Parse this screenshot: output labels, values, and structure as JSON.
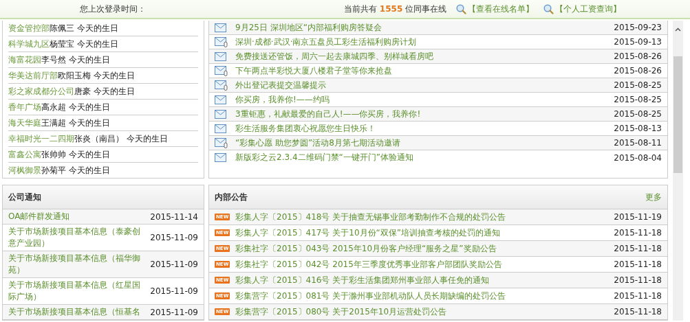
{
  "header": {
    "last_login_label": "您上次登录时间：",
    "online_prefix": "当前共有",
    "online_count": "1555",
    "online_suffix": "位同事在线",
    "links": [
      {
        "label": "【查看在线名单】"
      },
      {
        "label": "【个人工资查询】"
      }
    ]
  },
  "birthdays": [
    {
      "dept": "资金管控部",
      "name": "陈佩三 今天的生日"
    },
    {
      "dept": "科学城九区",
      "name": "杨莹宝 今天的生日"
    },
    {
      "dept": "海富花园",
      "name": "李号然 今天的生日"
    },
    {
      "dept": "华美达前厅部",
      "name": "欧阳玉梅 今天的生日"
    },
    {
      "dept": "彩之家成都分公司",
      "name": "唐豪 今天的生日"
    },
    {
      "dept": "香年广场",
      "name": "高永超 今天的生日"
    },
    {
      "dept": "海天华庭",
      "name": "王满超 今天的生日"
    },
    {
      "dept": "幸福时光一二四期",
      "name": "张炎（南昌） 今天的生日"
    },
    {
      "dept": "富鑫公寓",
      "name": "张帅帅 今天的生日"
    },
    {
      "dept": "河枫御景",
      "name": "孙菊平 今天的生日"
    }
  ],
  "messages": [
    {
      "kind": "mail",
      "title": "9月25日 深圳地区“内部福利购房答疑会",
      "date": "2015-09-23"
    },
    {
      "kind": "mail-attachment",
      "title": "深圳·成都·武汉·南京五盘员工彩生活福利购房计划",
      "date": "2015-09-13"
    },
    {
      "kind": "mail",
      "title": "免费接送还管饭，周六一起去康城四季、别样城看房吧",
      "date": "2015-08-26"
    },
    {
      "kind": "mail-attachment",
      "title": "下午两点半彩悦大厦八楼君子堂等你来抢盘",
      "date": "2015-08-26"
    },
    {
      "kind": "mail-attachment",
      "title": "外出登记表提交温馨提示",
      "date": "2015-08-25"
    },
    {
      "kind": "mail",
      "title": "你买房，我养你!——约吗",
      "date": "2015-08-25"
    },
    {
      "kind": "mail",
      "title": "3重钜惠，礼献最爱的自己人!——你买房，我养你!",
      "date": "2015-08-25"
    },
    {
      "kind": "mail",
      "title": "彩生活服务集团衷心祝愿您生日快乐！",
      "date": "2015-08-13"
    },
    {
      "kind": "mail-attachment",
      "title": "“彩集心愿 助您梦圆”活动8月第七期活动邀请",
      "date": "2015-08-11"
    },
    {
      "kind": "mail",
      "title": "新版彩之云2.3.4二维码门禁“一键开门”体验通知",
      "date": "2015-08-04"
    }
  ],
  "company_notices": {
    "title": "公司通知",
    "rows": [
      {
        "title": "OA邮件群发通知",
        "date": "2015-11-14"
      },
      {
        "title": "关于市场新接项目基本信息（泰豪创意产业园）",
        "date": "2015-11-09"
      },
      {
        "title": "关于市场新接项目基本信息（福华御苑）",
        "date": "2015-11-09"
      },
      {
        "title": "关于市场新接项目基本信息（红星国际广场）",
        "date": "2015-11-09"
      },
      {
        "title": "关于市场新接项目基本信息（恒基名",
        "date": "2015-11-09"
      }
    ]
  },
  "internal_notices": {
    "title": "内部公告",
    "more": "更多",
    "rows": [
      {
        "badge": "NEW",
        "title": "彩集人字〔2015〕418号 关于抽查无锡事业部考勤制作不合规的处罚公告",
        "date": "2015-11-19"
      },
      {
        "badge": "NEW",
        "title": "彩集人字〔2015〕417号 关于10月份“双保”培训抽查考核的处罚的通知",
        "date": "2015-11-18"
      },
      {
        "badge": "NEW",
        "title": "彩集社字〔2015〕043号 2015年10月份客户经理“服务之星”奖励公告",
        "date": "2015-11-18"
      },
      {
        "badge": "NEW",
        "title": "彩集社字〔2015〕042号 2015年三季度优秀事业部客户部团队奖励公告",
        "date": "2015-11-18"
      },
      {
        "badge": "NEW",
        "title": "彩集人字〔2015〕416号 关于彩生活集团郑州事业部人事任免的通知",
        "date": "2015-11-18"
      },
      {
        "badge": "NEW",
        "title": "彩集营字〔2015〕081号 关于滁州事业部机动队人员长期缺编的处罚公告",
        "date": "2015-11-18"
      },
      {
        "badge": "NEW",
        "title": "彩集营字〔2015〕080号 关于2015年10月运营处罚公告",
        "date": "2015-11-18"
      }
    ]
  }
}
